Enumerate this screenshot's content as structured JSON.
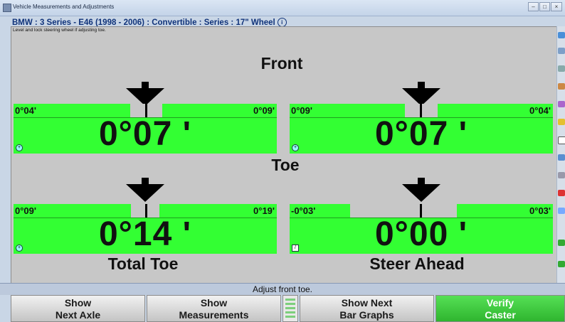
{
  "window": {
    "title": "Vehicle Measurements and Adjustments"
  },
  "vehicle": {
    "description": "BMW : 3 Series - E46 (1998 - 2006) : Convertible : Series : 17\" Wheel"
  },
  "instruction": "Level and lock steering wheel if adjusting toe.",
  "labels": {
    "front": "Front",
    "toe": "Toe",
    "total_toe": "Total Toe",
    "steer_ahead": "Steer Ahead"
  },
  "gauges": {
    "front_left_toe": {
      "min": "0°04'",
      "max": "0°09'",
      "value": "0°07 '"
    },
    "front_right_toe": {
      "min": "0°09'",
      "max": "0°04'",
      "value": "0°07 '"
    },
    "total_toe": {
      "min": "0°09'",
      "max": "0°19'",
      "value": "0°14 '"
    },
    "steer_ahead": {
      "min": "-0°03'",
      "max": "0°03'",
      "value": "0°00 '"
    }
  },
  "status": "Adjust front toe.",
  "buttons": {
    "next_axle": {
      "line1": "Show",
      "line2": "Next Axle"
    },
    "measurements": {
      "line1": "Show",
      "line2": "Measurements"
    },
    "next_bar_graphs": {
      "line1": "Show Next",
      "line2": "Bar Graphs"
    },
    "verify_caster": {
      "line1": "Verify",
      "line2": "Caster"
    }
  },
  "colors": {
    "bar_green": "#33ff33",
    "button_green": "#3ccc3c",
    "title_blue": "#10337a"
  },
  "icons": [
    "app-icon",
    "info-icon",
    "arrow-down-icon",
    "zoom-icon",
    "tool-icon"
  ]
}
